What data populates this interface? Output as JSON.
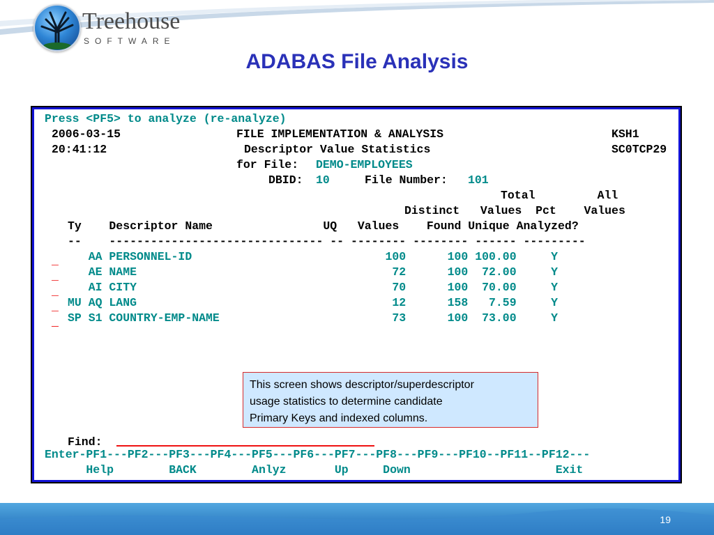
{
  "colors": {
    "title": "#2a31b8",
    "terminal_border": "#1212d4",
    "text_black": "#000000",
    "text_teal": "#008a8a",
    "text_red": "#ee1111",
    "callout_bg": "#cfe8ff",
    "callout_border": "#d62a2a",
    "footer": "#1d6ab5"
  },
  "header": {
    "logo": {
      "name": "Treehouse",
      "sub": "SOFTWARE",
      "icon": "tree-icon"
    },
    "title": "ADABAS File Analysis"
  },
  "terminal": {
    "prompt": "Press <PF5> to analyze (re-analyze)",
    "date": "2006-03-15",
    "time": "20:41:12",
    "title1": "FILE IMPLEMENTATION & ANALYSIS",
    "title2": "Descriptor Value Statistics",
    "user": "KSH1",
    "program": "SC0TCP29",
    "file_label": "for File:",
    "file_name": "DEMO-EMPLOYEES",
    "dbid_label": "DBID:",
    "dbid": "10",
    "filenum_label": "File Number:",
    "filenum": "101",
    "header_line1": "Total         All",
    "header_line2": "Distinct   Values  Pct    Values",
    "header_line3": "Ty    Descriptor Name                UQ   Values    Found Unique Analyzed?",
    "separator": "--    ------------------------------- -- -------- -------- ------ ---------",
    "rows": [
      {
        "sel": "_",
        "ty": "  ",
        "code": "AA",
        "name": "PERSONNEL-ID",
        "uq": "  ",
        "distinct": "100",
        "total": "100",
        "pct": "100.00",
        "analyzed": "Y"
      },
      {
        "sel": "_",
        "ty": "  ",
        "code": "AE",
        "name": "NAME",
        "uq": "  ",
        "distinct": "72",
        "total": "100",
        "pct": "72.00",
        "analyzed": "Y"
      },
      {
        "sel": "_",
        "ty": "  ",
        "code": "AI",
        "name": "CITY",
        "uq": "  ",
        "distinct": "70",
        "total": "100",
        "pct": "70.00",
        "analyzed": "Y"
      },
      {
        "sel": "_",
        "ty": "MU",
        "code": "AQ",
        "name": "LANG",
        "uq": "  ",
        "distinct": "12",
        "total": "158",
        "pct": "7.59",
        "analyzed": "Y"
      },
      {
        "sel": "_",
        "ty": "SP",
        "code": "S1",
        "name": "COUNTRY-EMP-NAME",
        "uq": "  ",
        "distinct": "73",
        "total": "100",
        "pct": "73.00",
        "analyzed": "Y"
      }
    ],
    "extra_selector": "_",
    "find_label": "Find:",
    "find_value": "",
    "pf_line": "Enter-PF1---PF2---PF3---PF4---PF5---PF6---PF7---PF8---PF9---PF10--PF11--PF12---",
    "pf_labels": "      Help        BACK        Anlyz       Up     Down                     Exit"
  },
  "callout": {
    "lines": [
      "This screen shows descriptor/superdescriptor",
      "usage statistics to determine candidate",
      "Primary Keys and indexed columns."
    ]
  },
  "footer": {
    "page": "19"
  }
}
